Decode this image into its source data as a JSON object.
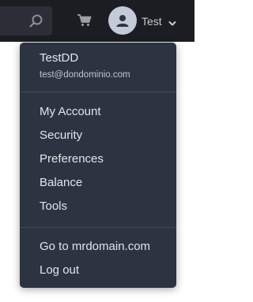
{
  "header": {
    "search_icon": "search-icon",
    "cart_icon": "cart-icon",
    "user": {
      "avatar_icon": "user-icon",
      "name": "Test",
      "chevron_icon": "chevron-down-icon"
    }
  },
  "dropdown": {
    "account": {
      "username": "TestDD",
      "email": "test@dondominio.com"
    },
    "items": [
      {
        "label": "My Account"
      },
      {
        "label": "Security"
      },
      {
        "label": "Preferences"
      },
      {
        "label": "Balance"
      },
      {
        "label": "Tools"
      }
    ],
    "footer_items": [
      {
        "label": "Go to mrdomain.com"
      },
      {
        "label": "Log out"
      }
    ]
  },
  "colors": {
    "topbar_bg": "#1b1d23",
    "dropdown_bg": "#2d3441",
    "text": "#e2e5ea",
    "avatar_bg": "#c5cad9"
  }
}
